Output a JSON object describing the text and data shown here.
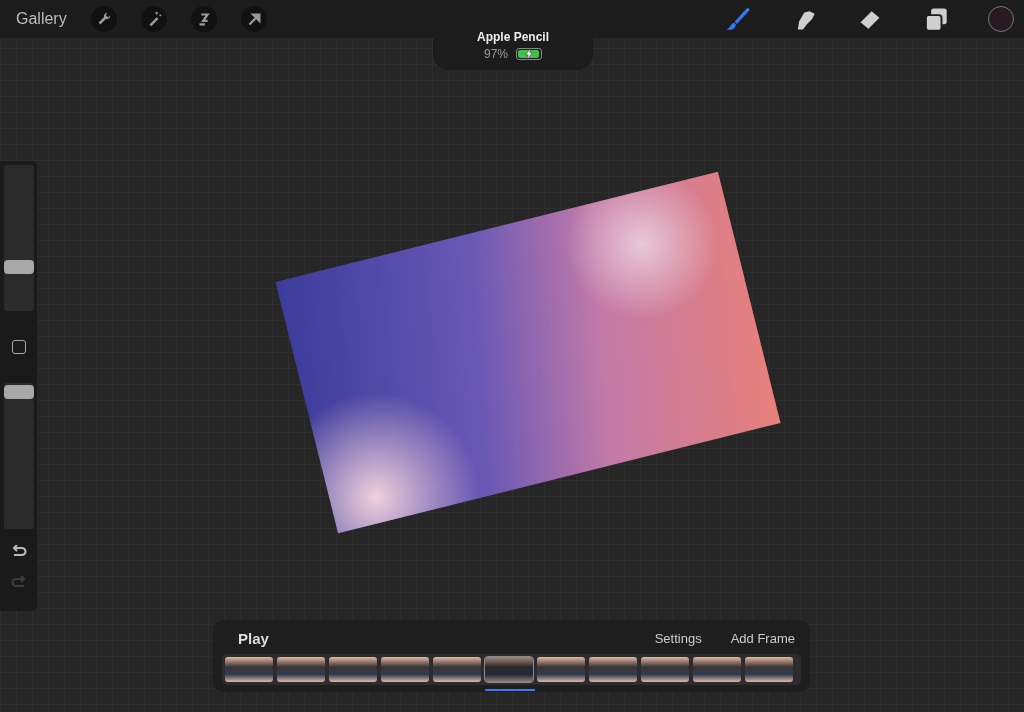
{
  "top_bar": {
    "gallery": "Gallery",
    "actions": [
      {
        "kind": "wrench"
      },
      {
        "kind": "wand"
      },
      {
        "kind": "selection"
      },
      {
        "kind": "transform"
      }
    ],
    "tools": [
      {
        "kind": "brush",
        "selected": true
      },
      {
        "kind": "smudge",
        "selected": false
      },
      {
        "kind": "eraser",
        "selected": false
      },
      {
        "kind": "layers",
        "selected": false
      }
    ]
  },
  "pencil_status": {
    "title": "Apple Pencil",
    "battery": "97%",
    "level": 0.97,
    "charging": true
  },
  "sidebar": {
    "size_slider": {
      "level": 0.3
    },
    "opacity_slider": {
      "level": 0.94
    },
    "redo_disabled": true
  },
  "timeline": {
    "play": "Play",
    "settings": "Settings",
    "add_frame": "Add Frame",
    "frames": [
      {
        "selected": false
      },
      {
        "selected": false
      },
      {
        "selected": false
      },
      {
        "selected": false
      },
      {
        "selected": false
      },
      {
        "selected": true
      },
      {
        "selected": false
      },
      {
        "selected": false
      },
      {
        "selected": false
      },
      {
        "selected": false
      },
      {
        "selected": false
      }
    ]
  }
}
